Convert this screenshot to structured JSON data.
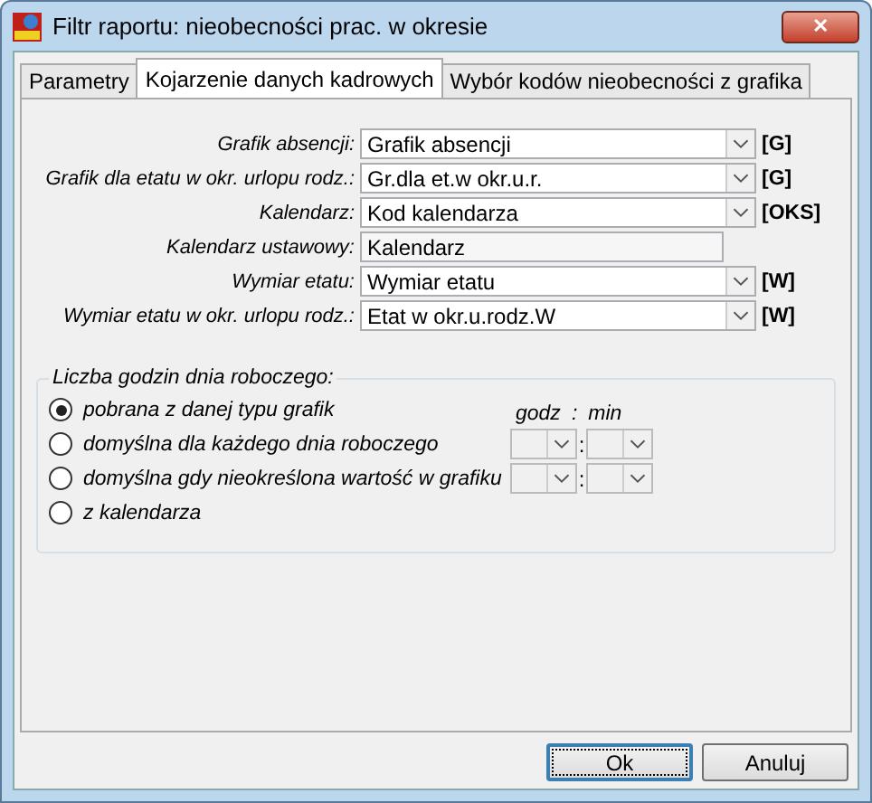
{
  "window": {
    "title": "Filtr raportu: nieobecności prac. w okresie",
    "close": "✕"
  },
  "tabs": [
    {
      "label": "Parametry",
      "selected": false
    },
    {
      "label": "Kojarzenie danych kadrowych",
      "selected": true
    },
    {
      "label": "Wybór kodów nieobecności z grafika",
      "selected": false
    }
  ],
  "fields": [
    {
      "kind": "combo",
      "label": "Grafik absencji:",
      "value": "Grafik absencji",
      "code": "[G]"
    },
    {
      "kind": "combo",
      "label": "Grafik dla etatu w okr. urlopu rodz.:",
      "value": "Gr.dla et.w okr.u.r.",
      "code": "[G]"
    },
    {
      "kind": "combo",
      "label": "Kalendarz:",
      "value": "Kod kalendarza",
      "code": "[OKS]"
    },
    {
      "kind": "text",
      "label": "Kalendarz ustawowy:",
      "value": "Kalendarz"
    },
    {
      "kind": "combo",
      "label": "Wymiar etatu:",
      "value": "Wymiar etatu",
      "code": "[W]"
    },
    {
      "kind": "combo",
      "label": "Wymiar etatu w okr. urlopu rodz.:",
      "value": "Etat w okr.u.rodz.W",
      "code": "[W]"
    }
  ],
  "hours_group": {
    "title": "Liczba godzin dnia roboczego:",
    "hour_header": "godz",
    "separator_header": ":",
    "minute_header": "min",
    "options": [
      {
        "label": "pobrana z danej typu grafik",
        "selected": true,
        "time_inputs": false
      },
      {
        "label": "domyślna dla każdego dnia roboczego",
        "selected": false,
        "time_inputs": true,
        "separator": ":"
      },
      {
        "label": "domyślna gdy nieokreślona wartość w grafiku",
        "selected": false,
        "time_inputs": true,
        "separator": ":"
      },
      {
        "label": "z kalendarza",
        "selected": false,
        "time_inputs": false
      }
    ]
  },
  "buttons": [
    {
      "label": "Ok",
      "default": true
    },
    {
      "label": "Anuluj",
      "default": false
    }
  ]
}
